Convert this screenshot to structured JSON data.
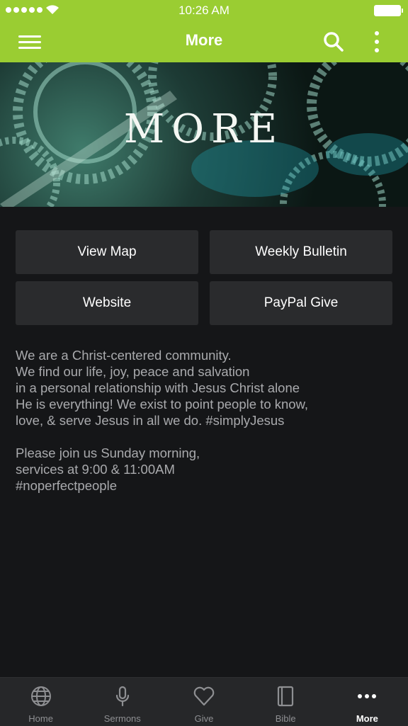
{
  "status_bar": {
    "time": "10:26 AM"
  },
  "header": {
    "title": "More"
  },
  "banner": {
    "text": "MORE"
  },
  "buttons": [
    {
      "label": "View Map"
    },
    {
      "label": "Weekly Bulletin"
    },
    {
      "label": "Website"
    },
    {
      "label": "PayPal Give"
    }
  ],
  "about": {
    "lines": [
      "We are a Christ-centered community.",
      "We find our life, joy, peace and salvation",
      "in a personal relationship with Jesus Christ alone",
      "He is everything! We exist to point people to know,",
      "love, & serve Jesus in all we do. #simplyJesus",
      "",
      "Please join us Sunday morning,",
      "services at 9:00 & 11:00AM",
      "#noperfectpeople"
    ]
  },
  "tabbar": {
    "tabs": [
      {
        "label": "Home",
        "icon": "globe-icon"
      },
      {
        "label": "Sermons",
        "icon": "microphone-icon"
      },
      {
        "label": "Give",
        "icon": "heart-icon"
      },
      {
        "label": "Bible",
        "icon": "book-icon"
      },
      {
        "label": "More",
        "icon": "more-dots-icon",
        "active": true
      }
    ]
  },
  "colors": {
    "header": "#9acd32",
    "background": "#151618",
    "button": "#2a2b2d",
    "tabbar": "#262729"
  }
}
